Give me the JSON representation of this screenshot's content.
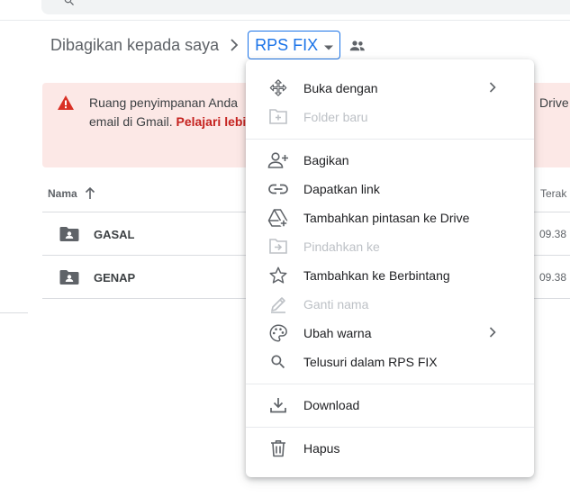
{
  "breadcrumb": {
    "parent": "Dibagikan kepada saya",
    "current": "RPS FIX"
  },
  "banner": {
    "text": "Ruang penyimpanan Anda",
    "text2": "email di Gmail.",
    "link": "Pelajari lebi",
    "right": "Drive"
  },
  "table": {
    "col_name": "Nama",
    "col_date": "Terak",
    "rows": [
      {
        "name": "GASAL",
        "date": "09.38"
      },
      {
        "name": "GENAP",
        "date": "09.38"
      }
    ]
  },
  "menu": {
    "items": [
      {
        "label": "Buka dengan",
        "icon": "move-arrows-icon",
        "submenu": true,
        "disabled": false
      },
      {
        "label": "Folder baru",
        "icon": "new-folder-icon",
        "submenu": false,
        "disabled": true
      },
      {
        "label": "Bagikan",
        "icon": "person-add-icon",
        "submenu": false,
        "disabled": false
      },
      {
        "label": "Dapatkan link",
        "icon": "link-icon",
        "submenu": false,
        "disabled": false
      },
      {
        "label": "Tambahkan pintasan ke Drive",
        "icon": "drive-shortcut-icon",
        "submenu": false,
        "disabled": false
      },
      {
        "label": "Pindahkan ke",
        "icon": "move-folder-icon",
        "submenu": false,
        "disabled": true
      },
      {
        "label": "Tambahkan ke Berbintang",
        "icon": "star-icon",
        "submenu": false,
        "disabled": false
      },
      {
        "label": "Ganti nama",
        "icon": "pencil-icon",
        "submenu": false,
        "disabled": true
      },
      {
        "label": "Ubah warna",
        "icon": "palette-icon",
        "submenu": true,
        "disabled": false
      },
      {
        "label": "Telusuri dalam RPS FIX",
        "icon": "search-icon",
        "submenu": false,
        "disabled": false
      },
      {
        "label": "Download",
        "icon": "download-icon",
        "submenu": false,
        "disabled": false
      },
      {
        "label": "Hapus",
        "icon": "trash-icon",
        "submenu": false,
        "disabled": false
      }
    ]
  },
  "colors": {
    "accent": "#1a73e8",
    "banner_bg": "#fce8e6",
    "warning": "#d93025",
    "link": "#c5221f"
  }
}
